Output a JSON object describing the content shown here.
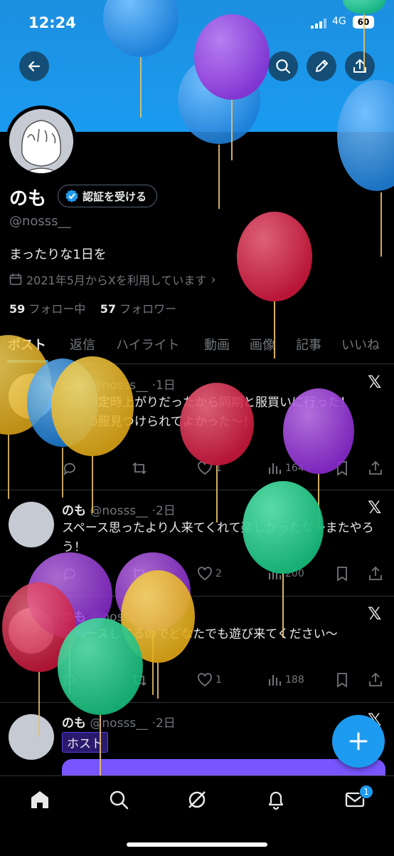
{
  "status": {
    "time": "12:24",
    "network": "4G",
    "battery": "60"
  },
  "profile": {
    "name": "のも",
    "verify_button": "認証を受ける",
    "handle": "@nosss__",
    "bio": "まったりな1日を",
    "joined": "2021年5月からXを利用しています",
    "following_count": "59",
    "following_label": "フォロー中",
    "followers_count": "57",
    "followers_label": "フォロワー"
  },
  "tabs": [
    "ポスト",
    "返信",
    "ハイライト",
    "動画",
    "画像",
    "記事",
    "いいね"
  ],
  "posts": [
    {
      "name": "のも",
      "handle": "@nosss__",
      "time": "·1日",
      "text": "今日は定時上がりだったから同期と服買いに行った！\n好みの服見つけられてよかった〜！",
      "likes": "1",
      "views": "164"
    },
    {
      "name": "のも",
      "handle": "@nosss__",
      "time": "·2日",
      "text": "スペース思ったより人来てくれて楽しかったな〜またやろう！",
      "likes": "2",
      "views": "200"
    },
    {
      "name": "のも",
      "handle": "@nosss__",
      "time": "·2日",
      "text": "スペースしてるのでどなたでも遊び来てください〜",
      "likes": "1",
      "views": "188"
    },
    {
      "name": "のも",
      "handle": "@nosss__",
      "time": "·2日",
      "badge": "ホスト"
    }
  ],
  "nav": {
    "messages_badge": "1"
  },
  "colors": {
    "accent": "#1d9bf0",
    "banner": "#1a9bf0",
    "space": "#7856ff"
  }
}
